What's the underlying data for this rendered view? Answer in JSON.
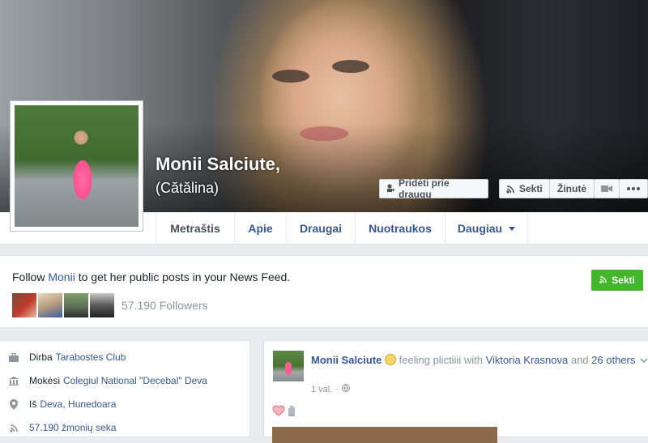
{
  "profile": {
    "name": "Monii Salciute,",
    "alternate_name": "(Cătălina)"
  },
  "cover_actions": {
    "add_friend": "Pridėti prie draugų",
    "follow": "Sekti",
    "message": "Žinutė"
  },
  "tabs": [
    {
      "label": "Metraštis",
      "active": true
    },
    {
      "label": "Apie"
    },
    {
      "label": "Draugai"
    },
    {
      "label": "Nuotraukos"
    },
    {
      "label": "Daugiau"
    }
  ],
  "follow_panel": {
    "prefix": "Follow ",
    "name_link": "Monii",
    "suffix": " to get her public posts in your News Feed.",
    "followers": "57.190 Followers",
    "button": "Sekti"
  },
  "intro": [
    {
      "icon": "briefcase-icon",
      "label": "Dirba",
      "link": "Tarabostes Club"
    },
    {
      "icon": "school-icon",
      "label": "Mokėsi",
      "link": "Colegiul National \"Decebal\" Deva"
    },
    {
      "icon": "location-pin-icon",
      "label": "Iš",
      "link": "Deva, Hunedoara"
    },
    {
      "icon": "feed-icon",
      "label": "",
      "link": "57.190 žmonių seka"
    }
  ],
  "post": {
    "author": "Monii Salciute",
    "feeling": " feeling plictiiii with ",
    "tagged": "Viktoria Krasnova",
    "and": " and ",
    "others": "26 others",
    "time": "1 val.",
    "dot": "·"
  },
  "colors": {
    "link": "#365899",
    "green": "#42b72a",
    "page_bg": "#e9ebee"
  }
}
